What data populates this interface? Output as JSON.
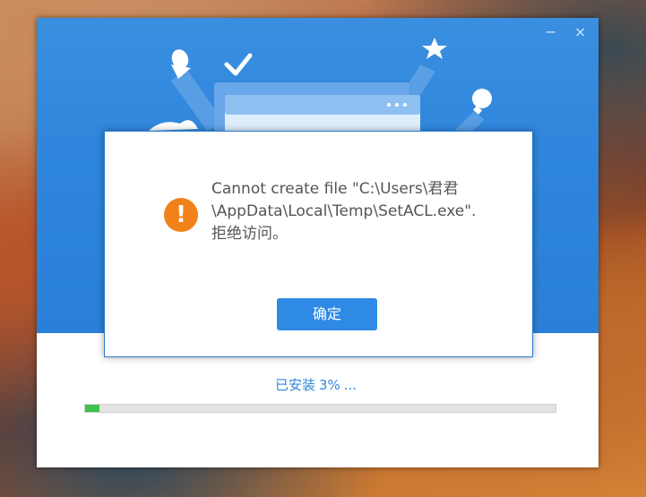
{
  "window": {
    "minimize_glyph": "−",
    "close_glyph": "×"
  },
  "dialog": {
    "message_lines": [
      "Cannot create file \"C:\\Users\\君君",
      "\\AppData\\Local\\Temp\\SetACL.exe\".",
      "拒绝访问。"
    ],
    "icon": "warning-icon",
    "icon_glyph": "!",
    "ok_label": "确定"
  },
  "progress": {
    "status_prefix": "已安装",
    "percent_label": "3%",
    "ellipsis": "...",
    "fraction": 0.03
  },
  "colors": {
    "accent": "#2f86dc",
    "warning": "#f08219",
    "progress_fill": "#3fc14a",
    "button": "#2f8ae5"
  }
}
